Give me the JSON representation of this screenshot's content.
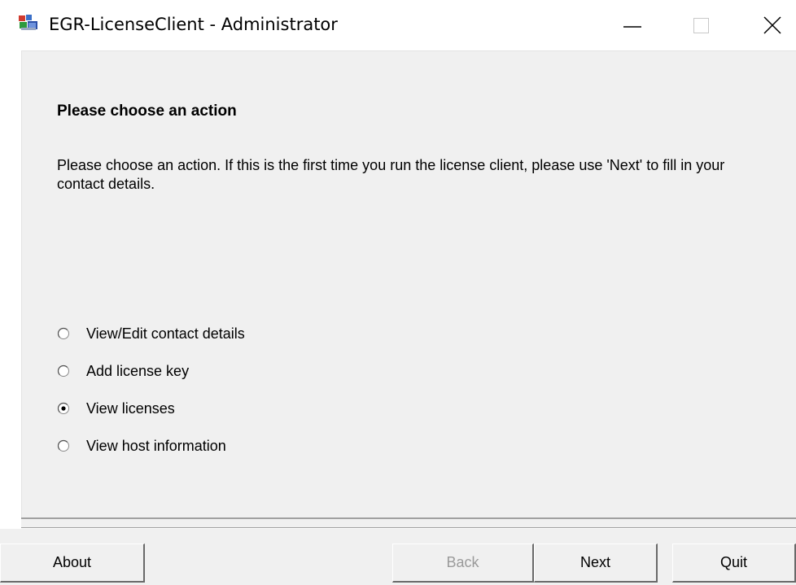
{
  "window": {
    "title": "EGR-LicenseClient - Administrator",
    "icon": "egr-app-icon",
    "controls": {
      "minimize_icon": "minimize-icon",
      "maximize_icon": "maximize-icon",
      "close_icon": "close-icon"
    }
  },
  "page": {
    "heading": "Please choose an action",
    "description": "Please choose an action. If this is the first time you run the license client, please use 'Next' to fill in your contact details."
  },
  "options": [
    {
      "label": "View/Edit contact details",
      "selected": false
    },
    {
      "label": "Add license key",
      "selected": false
    },
    {
      "label": "View licenses",
      "selected": true
    },
    {
      "label": "View host information",
      "selected": false
    }
  ],
  "buttons": {
    "about": "About",
    "back": "Back",
    "next": "Next",
    "quit": "Quit"
  },
  "colors": {
    "dialog_bg": "#f0f0f0",
    "disabled_text": "#9a9a9a",
    "border_dark": "#696969"
  }
}
